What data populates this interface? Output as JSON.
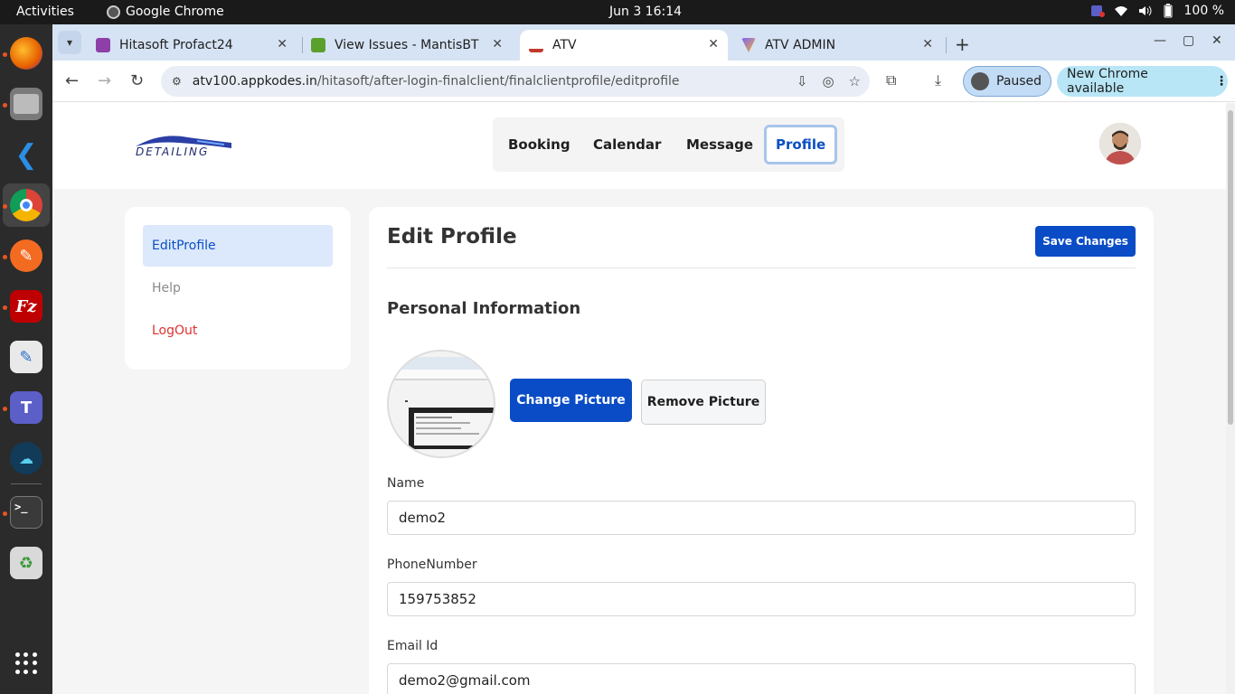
{
  "system": {
    "activities": "Activities",
    "app_name": "Google Chrome",
    "clock": "Jun 3  16:14",
    "battery": "100 %"
  },
  "browser": {
    "tabs": [
      {
        "title": "Hitasoft Profact24",
        "favicon_color": "#8e3fa8"
      },
      {
        "title": "View Issues - MantisBT",
        "favicon_color": "#5aa02c"
      },
      {
        "title": "ATV",
        "favicon_color": "#c0392b"
      },
      {
        "title": "ATV ADMIN",
        "favicon_color": "#7b61ff"
      }
    ],
    "url_host": "atv100.appkodes.in",
    "url_path": "/hitasoft/after-login-finalclient/finalclientprofile/editprofile",
    "profile_status": "Paused",
    "update_notice": "New Chrome available"
  },
  "site": {
    "logo_text": "DETAILING",
    "nav": [
      "Booking",
      "Calendar",
      "Message",
      "Profile"
    ],
    "active_nav": "Profile",
    "accent": "#0a4cc6"
  },
  "sidebar": {
    "items": [
      {
        "label": "EditProfile"
      },
      {
        "label": "Help"
      },
      {
        "label": "LogOut"
      }
    ]
  },
  "main": {
    "title": "Edit Profile",
    "save_label": "Save Changes",
    "section_title": "Personal Information",
    "change_picture": "Change Picture",
    "remove_picture": "Remove Picture",
    "fields": [
      {
        "label": "Name",
        "value": "demo2"
      },
      {
        "label": "PhoneNumber",
        "value": "159753852"
      },
      {
        "label": "Email Id",
        "value": "demo2@gmail.com"
      }
    ]
  }
}
